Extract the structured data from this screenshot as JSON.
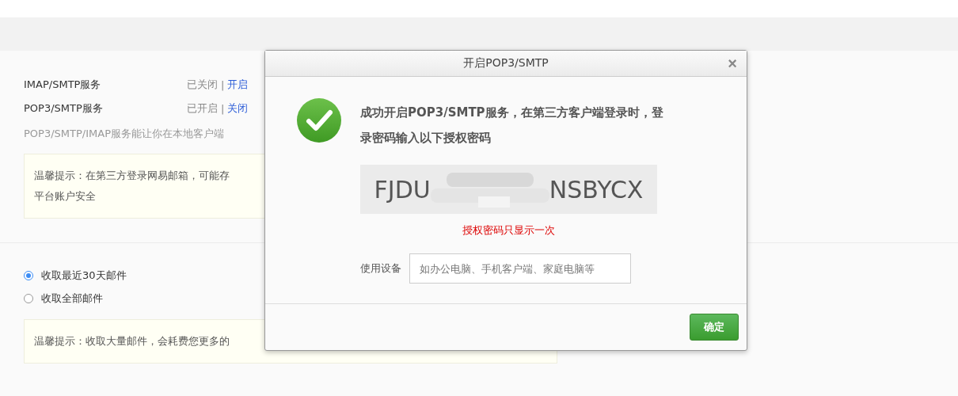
{
  "services": [
    {
      "name": "IMAP/SMTP服务",
      "status": "已关闭",
      "separator": "|",
      "action": "开启"
    },
    {
      "name": "POP3/SMTP服务",
      "status": "已开启",
      "separator": "|",
      "action": "关闭"
    }
  ],
  "description": "POP3/SMTP/IMAP服务能让你在本地客户端",
  "tip_top": {
    "lines": [
      "温馨提示：在第三方登录网易邮箱，可能存",
      "平台账户安全"
    ]
  },
  "fetch_options": [
    {
      "label": "收取最近30天邮件",
      "selected": true
    },
    {
      "label": "收取全部邮件",
      "selected": false
    }
  ],
  "tip_bottom": {
    "lines": [
      "温馨提示：收取大量邮件，会耗费您更多的"
    ]
  },
  "dialog": {
    "title": "开启POP3/SMTP",
    "close": "×",
    "message": "成功开启POP3/SMTP服务，在第三方客户端登录时，登录密码输入以下授权密码",
    "code_start": "FJDU",
    "code_end": "NSBYCX",
    "warning": "授权密码只显示一次",
    "device_label": "使用设备",
    "device_placeholder": "如办公电脑、手机客户端、家庭电脑等",
    "confirm": "确定"
  }
}
